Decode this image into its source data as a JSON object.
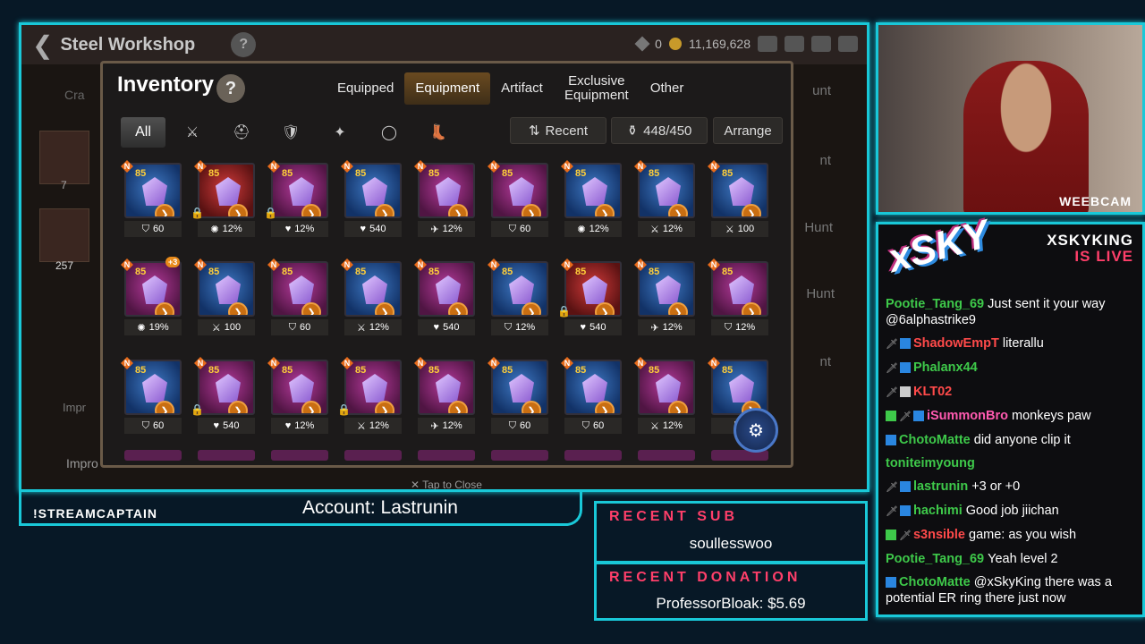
{
  "game": {
    "title": "Steel Workshop",
    "resources": {
      "stigma": "0",
      "gold": "11,169,628"
    },
    "side_labels": [
      "Cra",
      "7",
      "257",
      "Impr",
      "Impro"
    ],
    "right_labels": [
      "unt",
      "nt",
      "Hunt",
      "Hunt",
      "nt"
    ],
    "tap_close": "Tap to Close"
  },
  "inventory": {
    "title": "Inventory",
    "help": "?",
    "tabs": [
      {
        "label": "Equipped",
        "active": false
      },
      {
        "label": "Equipment",
        "active": true
      },
      {
        "label": "Artifact",
        "active": false
      },
      {
        "label": "Exclusive\nEquipment",
        "active": false
      },
      {
        "label": "Other",
        "active": false
      }
    ],
    "filters": [
      {
        "label": "All",
        "icon": "all-icon",
        "active": true
      },
      {
        "label": "⚔",
        "icon": "weapon-icon"
      },
      {
        "label": "⛑",
        "icon": "helmet-icon"
      },
      {
        "label": "🛡",
        "icon": "armor-icon"
      },
      {
        "label": "✦",
        "icon": "necklace-icon"
      },
      {
        "label": "◯",
        "icon": "ring-icon"
      },
      {
        "label": "👢",
        "icon": "boots-icon"
      }
    ],
    "sort_label": "Recent",
    "capacity": "448/450",
    "arrange_label": "Arrange",
    "items": [
      {
        "bg": "blue",
        "level": "85",
        "stat": "60",
        "stat_icon": "shield-icon",
        "locked": false,
        "plus": ""
      },
      {
        "bg": "red",
        "level": "85",
        "stat": "12%",
        "stat_icon": "crit-icon",
        "locked": true,
        "plus": ""
      },
      {
        "bg": "purple",
        "level": "85",
        "stat": "12%",
        "stat_icon": "heart-icon",
        "locked": true,
        "plus": ""
      },
      {
        "bg": "blue",
        "level": "85",
        "stat": "540",
        "stat_icon": "heart-icon",
        "locked": false,
        "plus": ""
      },
      {
        "bg": "purple",
        "level": "85",
        "stat": "12%",
        "stat_icon": "speed-icon",
        "locked": false,
        "plus": ""
      },
      {
        "bg": "purple",
        "level": "85",
        "stat": "60",
        "stat_icon": "shield-icon",
        "locked": false,
        "plus": ""
      },
      {
        "bg": "blue",
        "level": "85",
        "stat": "12%",
        "stat_icon": "crit-icon",
        "locked": false,
        "plus": ""
      },
      {
        "bg": "blue",
        "level": "85",
        "stat": "12%",
        "stat_icon": "attack-icon",
        "locked": false,
        "plus": ""
      },
      {
        "bg": "blue",
        "level": "85",
        "stat": "100",
        "stat_icon": "attack-icon",
        "locked": false,
        "plus": ""
      },
      {
        "bg": "purple",
        "level": "85",
        "stat": "19%",
        "stat_icon": "crit-icon",
        "locked": false,
        "plus": "+3"
      },
      {
        "bg": "blue",
        "level": "85",
        "stat": "100",
        "stat_icon": "attack-icon",
        "locked": false,
        "plus": ""
      },
      {
        "bg": "purple",
        "level": "85",
        "stat": "60",
        "stat_icon": "shield-icon",
        "locked": false,
        "plus": ""
      },
      {
        "bg": "blue",
        "level": "85",
        "stat": "12%",
        "stat_icon": "attack-icon",
        "locked": false,
        "plus": ""
      },
      {
        "bg": "purple",
        "level": "85",
        "stat": "540",
        "stat_icon": "heart-icon",
        "locked": false,
        "plus": ""
      },
      {
        "bg": "blue",
        "level": "85",
        "stat": "12%",
        "stat_icon": "shield-icon",
        "locked": false,
        "plus": ""
      },
      {
        "bg": "red",
        "level": "85",
        "stat": "540",
        "stat_icon": "heart-icon",
        "locked": true,
        "plus": ""
      },
      {
        "bg": "blue",
        "level": "85",
        "stat": "12%",
        "stat_icon": "speed-icon",
        "locked": false,
        "plus": ""
      },
      {
        "bg": "purple",
        "level": "85",
        "stat": "12%",
        "stat_icon": "shield-icon",
        "locked": false,
        "plus": ""
      },
      {
        "bg": "blue",
        "level": "85",
        "stat": "60",
        "stat_icon": "shield-icon",
        "locked": false,
        "plus": ""
      },
      {
        "bg": "purple",
        "level": "85",
        "stat": "540",
        "stat_icon": "heart-icon",
        "locked": true,
        "plus": ""
      },
      {
        "bg": "purple",
        "level": "85",
        "stat": "12%",
        "stat_icon": "heart-icon",
        "locked": false,
        "plus": ""
      },
      {
        "bg": "purple",
        "level": "85",
        "stat": "12%",
        "stat_icon": "attack-icon",
        "locked": true,
        "plus": ""
      },
      {
        "bg": "purple",
        "level": "85",
        "stat": "12%",
        "stat_icon": "speed-icon",
        "locked": false,
        "plus": ""
      },
      {
        "bg": "blue",
        "level": "85",
        "stat": "60",
        "stat_icon": "shield-icon",
        "locked": false,
        "plus": ""
      },
      {
        "bg": "blue",
        "level": "85",
        "stat": "60",
        "stat_icon": "shield-icon",
        "locked": false,
        "plus": ""
      },
      {
        "bg": "purple",
        "level": "85",
        "stat": "12%",
        "stat_icon": "attack-icon",
        "locked": false,
        "plus": ""
      },
      {
        "bg": "blue",
        "level": "85",
        "stat": "",
        "stat_icon": "shield-icon",
        "locked": false,
        "plus": ""
      }
    ]
  },
  "webcam": {
    "label": "WEEBCAM"
  },
  "chat": {
    "logo": "xSKY",
    "live_line1": "XSKYKING",
    "live_line2": "IS LIVE",
    "messages": [
      {
        "name": "Pootie_Tang_69",
        "color": "#3ec94a",
        "text": "Just sent it your way @6alphastrike9",
        "badges": []
      },
      {
        "name": "ShadowEmpT",
        "color": "#ff4a4a",
        "text": "literallu",
        "badges": [
          "sword",
          "blue"
        ]
      },
      {
        "name": "Phalanx44",
        "color": "#3ec94a",
        "text": "",
        "badges": [
          "sword",
          "blue"
        ]
      },
      {
        "name": "KLT02",
        "color": "#ff4a4a",
        "text": "",
        "badges": [
          "sword",
          "white"
        ]
      },
      {
        "name": "iSummonBro",
        "color": "#ff5ab0",
        "text": "monkeys paw",
        "badges": [
          "green",
          "sword",
          "blue"
        ]
      },
      {
        "name": "ChotoMatte",
        "color": "#3ec94a",
        "text": "did anyone clip it",
        "badges": [
          "blue"
        ]
      },
      {
        "name": "toniteimyoung",
        "color": "#3ec94a",
        "text": "",
        "badges": []
      },
      {
        "name": "lastrunin",
        "color": "#3ec94a",
        "text": "+3 or +0",
        "badges": [
          "sword",
          "blue"
        ]
      },
      {
        "name": "hachimi",
        "color": "#3ec94a",
        "text": "Good job jiichan",
        "badges": [
          "sword",
          "blue"
        ]
      },
      {
        "name": "s3nsible",
        "color": "#ff4a4a",
        "text": "game: as you wish",
        "badges": [
          "green",
          "sword"
        ]
      },
      {
        "name": "Pootie_Tang_69",
        "color": "#3ec94a",
        "text": "Yeah level 2",
        "badges": []
      },
      {
        "name": "ChotoMatte",
        "color": "#3ec94a",
        "text": "@xSkyKing there was a potential ER ring there just now",
        "badges": [
          "blue"
        ]
      }
    ]
  },
  "overlay": {
    "command": "!STREAMCAPTAIN",
    "account": "Account: Lastrunin",
    "recent_sub_label": "RECENT SUB",
    "recent_sub_value": "soullesswoo",
    "recent_donation_label": "RECENT DONATION",
    "recent_donation_value": "ProfessorBloak: $5.69"
  },
  "colors": {
    "accent": "#19c8d8",
    "live": "#ff3f6a"
  }
}
